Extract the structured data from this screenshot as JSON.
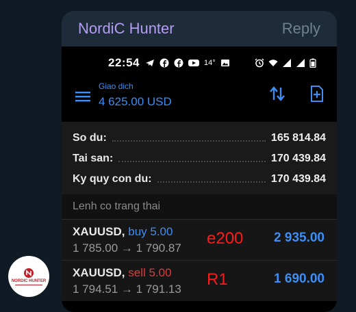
{
  "message": {
    "sender": "NordiC Hunter",
    "reply_label": "Reply",
    "avatar_logo_text": "NORDIC HUNTER"
  },
  "phone": {
    "status_bar": {
      "time": "22:54",
      "temperature": "14°",
      "icons_left": [
        "telegram-icon",
        "facebook-icon",
        "facebook-icon",
        "youtube-icon"
      ],
      "icons_right": [
        "image-icon",
        "alarm-icon",
        "wifi-icon",
        "signal-icon",
        "signal-icon",
        "battery-icon"
      ]
    },
    "app_bar": {
      "account_label": "Giao dich",
      "account_value": "4 625.00 USD"
    },
    "summary": [
      {
        "label": "So du:",
        "value": "165 814.84"
      },
      {
        "label": "Tai san:",
        "value": "170 439.84"
      },
      {
        "label": "Ky quy con du:",
        "value": "170 439.84"
      }
    ],
    "section_title": "Lenh co trang thai",
    "orders": [
      {
        "symbol": "XAUUSD,",
        "side": "buy 5.00",
        "side_color": "#3d8ef5",
        "open_price": "1 785.00",
        "arrow": "→",
        "current_price": "1 790.87",
        "note": "e200",
        "profit": "2 935.00"
      },
      {
        "symbol": "XAUUSD,",
        "side": "sell 5.00",
        "side_color": "#e23a3a",
        "open_price": "1 794.51",
        "arrow": "→",
        "current_price": "1 791.13",
        "note": "R1",
        "profit": "1 690.00"
      }
    ]
  },
  "colors": {
    "accent_blue": "#3d8ef5",
    "sender_purple": "#b59cf5",
    "note_red": "#ff1a1a",
    "chat_background": "#0f1a24",
    "bubble": "#1e2c3a"
  }
}
